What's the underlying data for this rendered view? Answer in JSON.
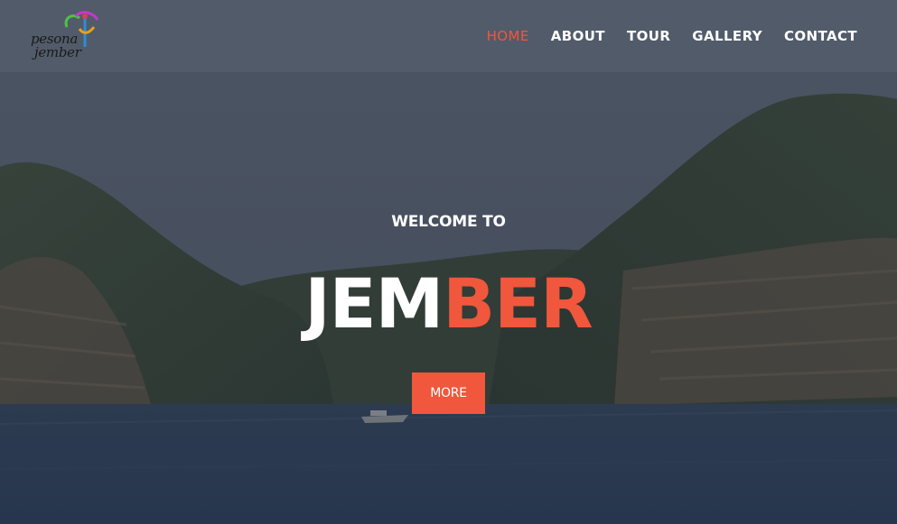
{
  "brand": {
    "logo_line1": "pesona",
    "logo_line2": "jember"
  },
  "nav": {
    "items": [
      {
        "label": "HOME",
        "active": true
      },
      {
        "label": "ABOUT",
        "active": false
      },
      {
        "label": "TOUR",
        "active": false
      },
      {
        "label": "GALLERY",
        "active": false
      },
      {
        "label": "CONTACT",
        "active": false
      }
    ]
  },
  "hero": {
    "welcome": "WELCOME TO",
    "title_part1": "JEM",
    "title_part2": "BER",
    "button_label": "MORE"
  },
  "colors": {
    "accent": "#f0573c",
    "header_bg": "#555e6c",
    "text": "#ffffff"
  }
}
